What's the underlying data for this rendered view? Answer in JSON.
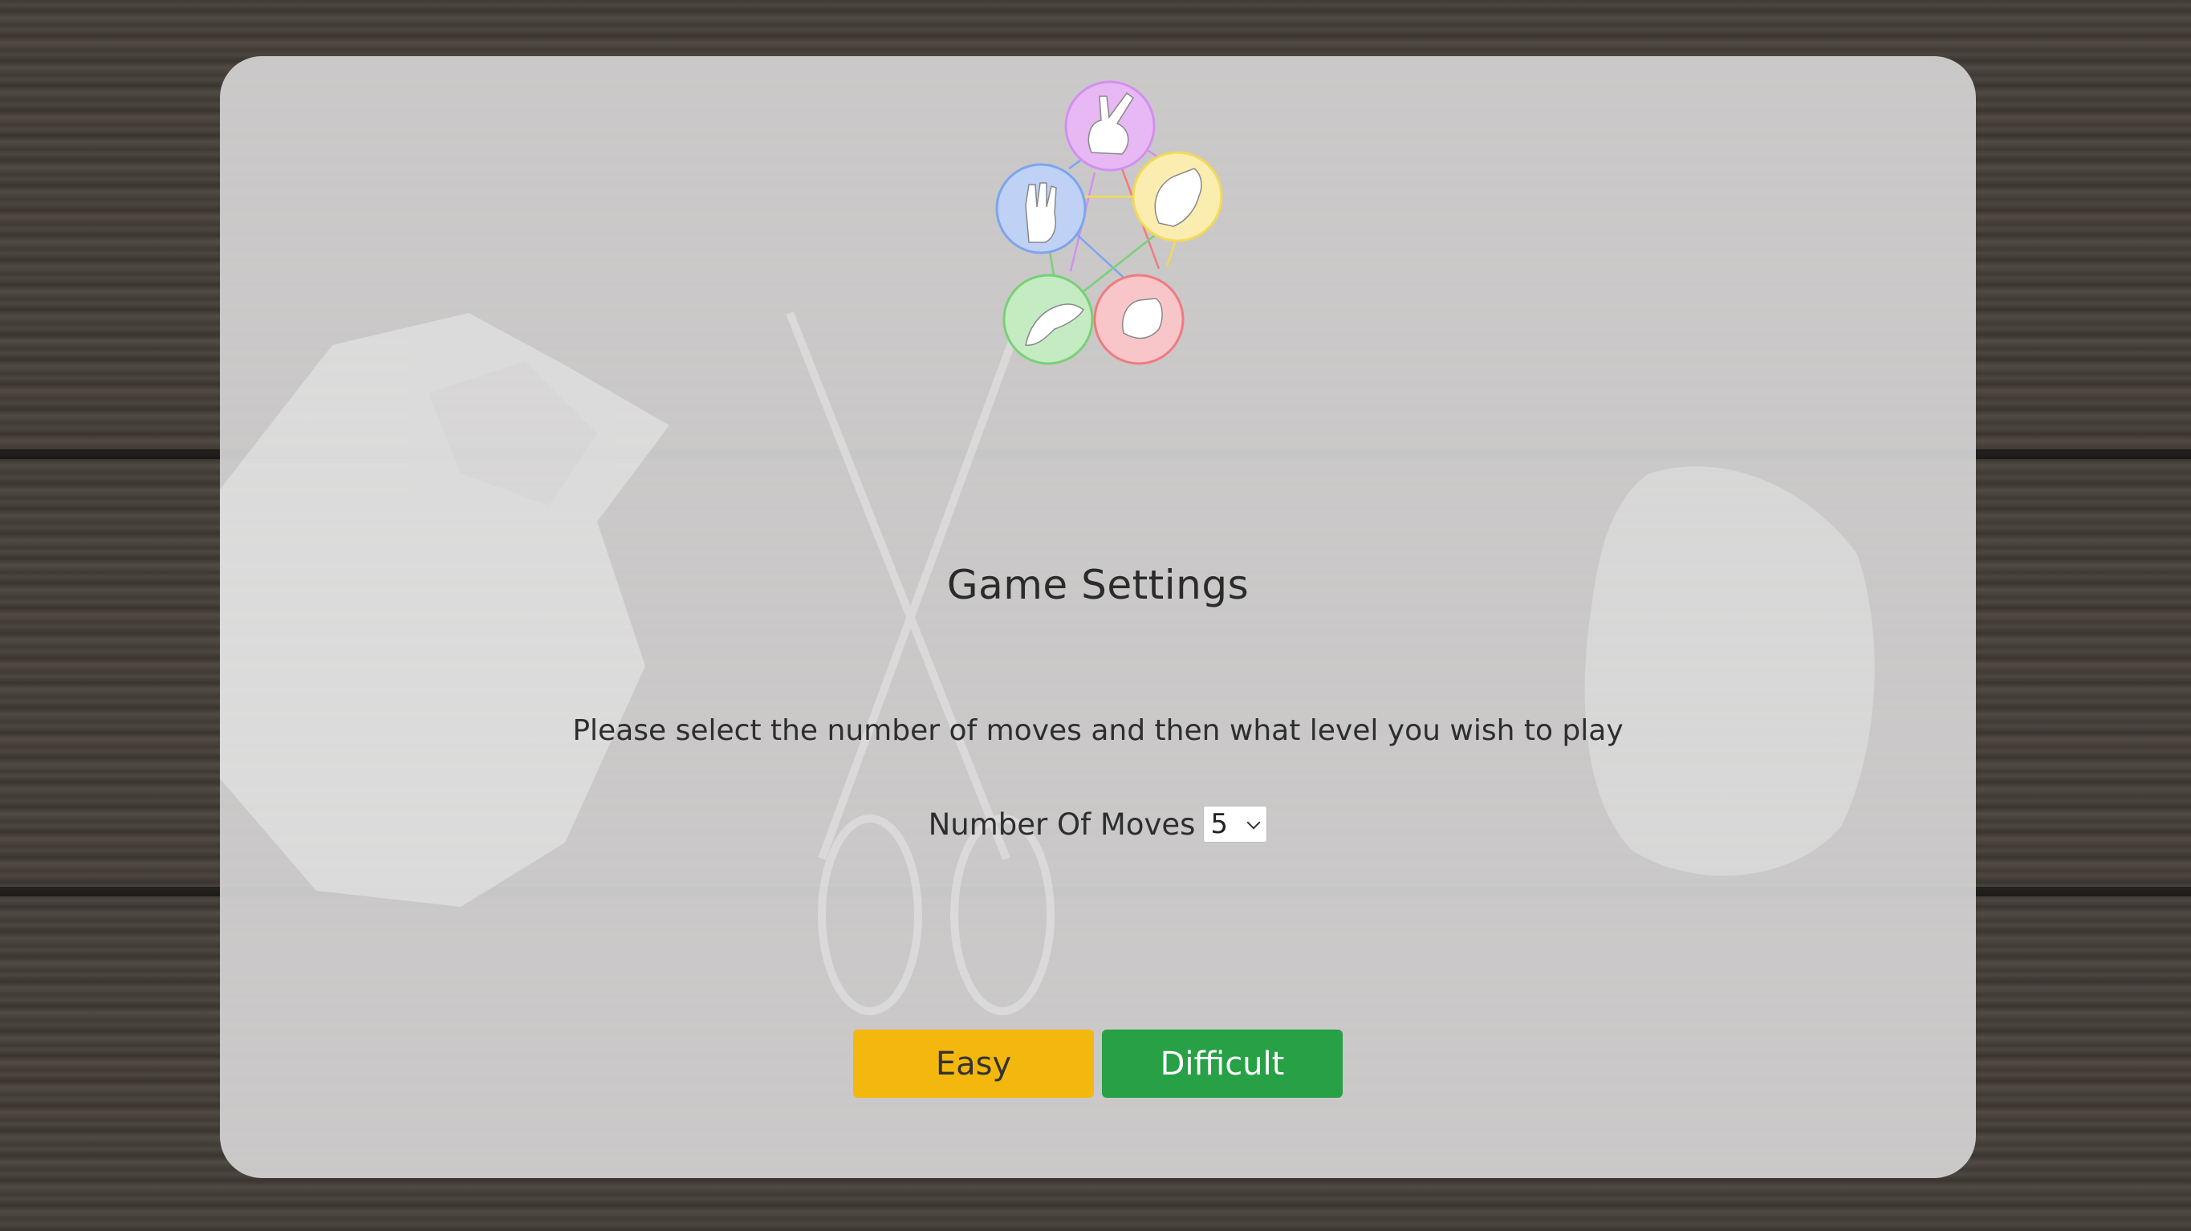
{
  "header": {
    "logo_icon": "rock-paper-scissors-lizard-spock-icon"
  },
  "main": {
    "title": "Game Settings",
    "instruction": "Please select the number of moves and then what level you wish to play",
    "moves": {
      "label": "Number Of Moves",
      "selected": "5"
    },
    "buttons": {
      "easy": "Easy",
      "difficult": "Difficult"
    }
  },
  "colors": {
    "easy_button": "#f4b70e",
    "difficult_button": "#27a046",
    "card_background": "#d4d3d3"
  }
}
